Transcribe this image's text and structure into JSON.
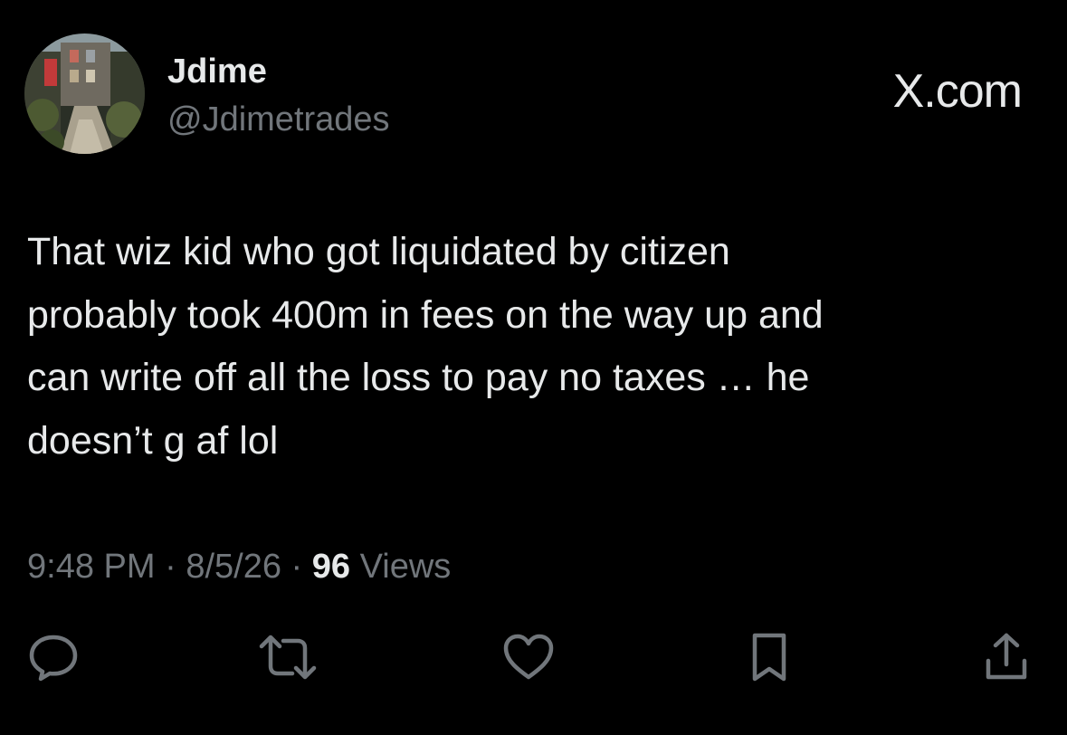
{
  "author": {
    "display_name": "Jdime",
    "handle": "@Jdimetrades",
    "avatar_icon": "avatar-alley-photo"
  },
  "brand": {
    "label": "X.com"
  },
  "tweet": {
    "lines": [
      "That wiz kid who got liquidated by citizen",
      "probably took 400m in fees on the way up and",
      "can write off all the loss to pay no taxes … he",
      "doesn’t g af lol"
    ]
  },
  "meta": {
    "time": "9:48 PM",
    "separator": "·",
    "date": "8/5/26",
    "views_count": "96",
    "views_label": "Views"
  },
  "actions": {
    "reply_icon": "reply-icon",
    "repost_icon": "repost-icon",
    "like_icon": "heart-icon",
    "bookmark_icon": "bookmark-icon",
    "share_icon": "share-icon"
  },
  "colors": {
    "background": "#000000",
    "primary_text": "#e7e9ea",
    "secondary_text": "#71767b"
  }
}
